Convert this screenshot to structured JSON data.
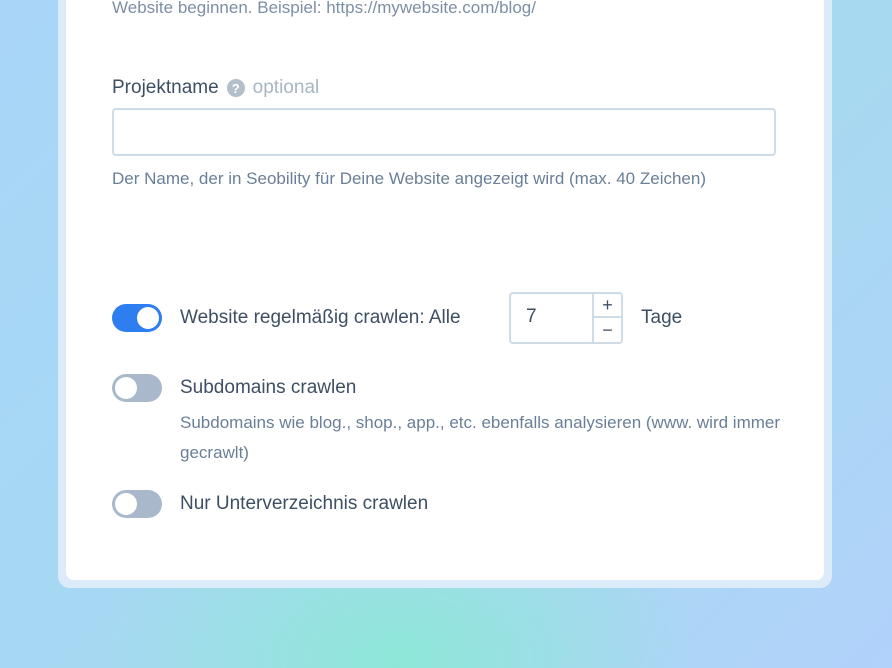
{
  "url_field": {
    "hint": "Website beginnen. Beispiel: https://mywebsite.com/blog/"
  },
  "project_name": {
    "label": "Projektname",
    "help_glyph": "?",
    "optional": "optional",
    "value": "",
    "placeholder": "",
    "hint": "Der Name, der in Seobility für Deine Website angezeigt wird (max. 40 Zeichen)"
  },
  "options": {
    "regular_crawl": {
      "checked": true,
      "label": "Website regelmäßig crawlen: Alle",
      "interval_value": "7",
      "plus": "+",
      "minus": "−",
      "unit": "Tage"
    },
    "subdomains": {
      "checked": false,
      "label": "Subdomains crawlen",
      "hint": "Subdomains wie blog., shop., app., etc. ebenfalls analysieren (www. wird immer gecrawlt)"
    },
    "subdirectory": {
      "checked": false,
      "label": "Nur Unterverzeichnis crawlen"
    }
  },
  "colors": {
    "accent": "#2e7ef0",
    "toggle_off": "#a9b9cb",
    "text": "#3e4f63",
    "hint": "#6a7f97",
    "border": "#cfdbe7"
  }
}
